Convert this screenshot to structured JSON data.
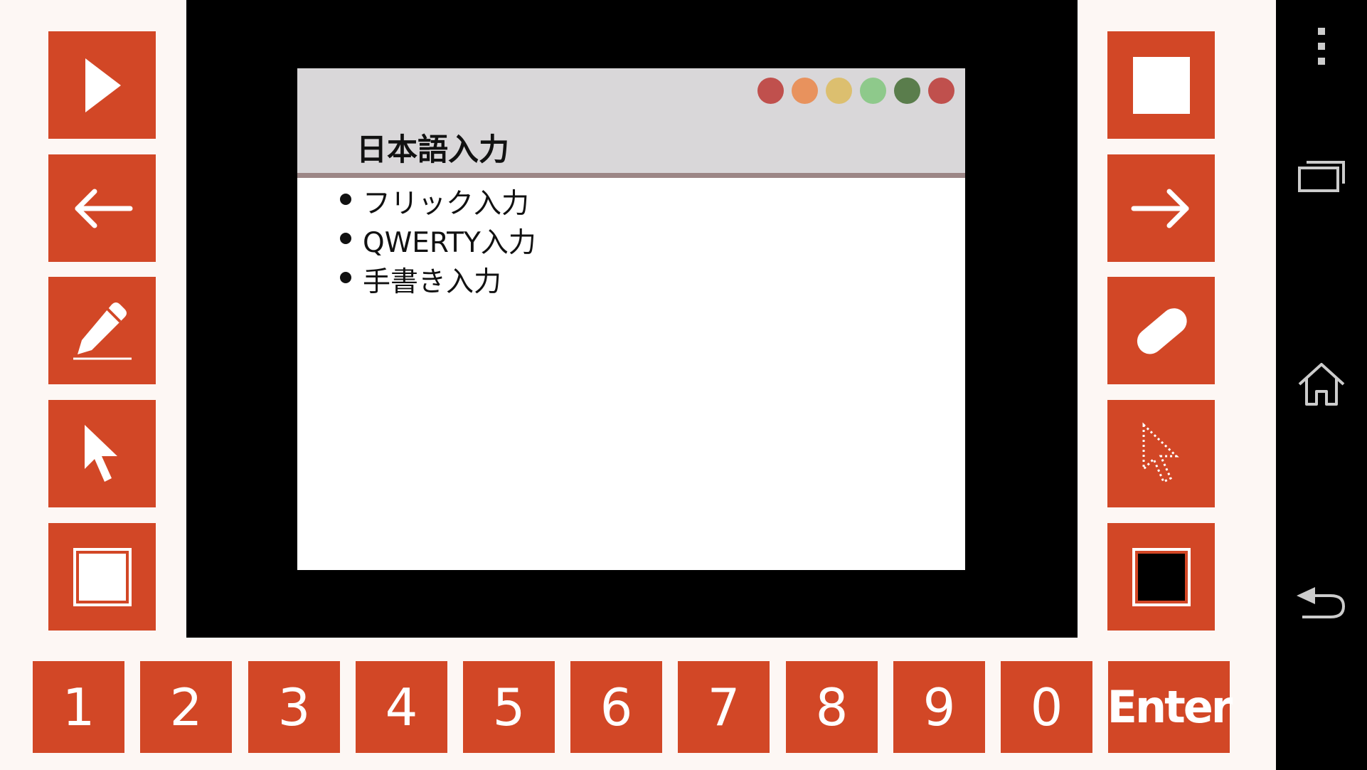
{
  "slide": {
    "title": "日本語入力",
    "bullets": [
      "フリック入力",
      "QWERTY入力",
      "手書き入力"
    ],
    "dot_colors": [
      "#c0504d",
      "#e8925d",
      "#dcbf6f",
      "#8ec98b",
      "#5a7d4c",
      "#c0504d"
    ]
  },
  "left_toolbar": [
    {
      "name": "play-button",
      "icon": "play-icon"
    },
    {
      "name": "previous-slide-button",
      "icon": "arrow-left-icon"
    },
    {
      "name": "pen-tool-button",
      "icon": "pen-icon"
    },
    {
      "name": "pointer-tool-button",
      "icon": "cursor-arrow-icon"
    },
    {
      "name": "white-screen-button",
      "icon": "white-square-icon"
    }
  ],
  "right_toolbar": [
    {
      "name": "stop-button",
      "icon": "stop-icon"
    },
    {
      "name": "next-slide-button",
      "icon": "arrow-right-icon"
    },
    {
      "name": "eraser-tool-button",
      "icon": "eraser-icon"
    },
    {
      "name": "laser-pointer-button",
      "icon": "dotted-cursor-icon"
    },
    {
      "name": "black-screen-button",
      "icon": "black-square-icon"
    }
  ],
  "keypad": {
    "keys": [
      "1",
      "2",
      "3",
      "4",
      "5",
      "6",
      "7",
      "8",
      "9",
      "0"
    ],
    "enter_label": "Enter"
  },
  "system_nav": {
    "menu": "overflow-menu-icon",
    "recents": "recent-apps-icon",
    "home": "home-icon",
    "back": "back-icon"
  },
  "colors": {
    "accent": "#d24726",
    "background": "#fdf7f4",
    "slide_header": "#d9d7d9",
    "slide_rule": "#9c8686"
  }
}
